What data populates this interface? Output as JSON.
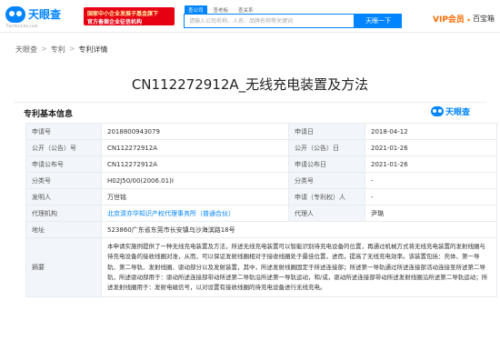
{
  "header": {
    "logo_text": "天眼查",
    "logo_sub": "TianYanCha.com",
    "promo_line1": "国家中小企业发展子基金旗下",
    "promo_line2": "官方备案企业征信机构",
    "search_tabs": [
      "查公司",
      "查老板",
      "查关系"
    ],
    "search_placeholder": "请输入公司名称、人名、品牌名称等关键词",
    "search_button": "天眼一下",
    "vip_label": "VIP会员",
    "vip_caret": "▾",
    "baobao": "百宝箱"
  },
  "breadcrumb": {
    "home": "天眼查",
    "level2": "专利",
    "current": "专利详情",
    "sep": ">"
  },
  "page_title": "CN112272912A_无线充电装置及方法",
  "section_title": "专利基本信息",
  "watermark_text": "天眼查",
  "table": {
    "application_no_label": "申请号",
    "application_no": "2018800943079",
    "application_date_label": "申请日",
    "application_date": "2018-04-12",
    "pub_no_label": "公开（公告）号",
    "pub_no": "CN112272912A",
    "pub_date_label": "公开（公告）日",
    "pub_date": "2021-01-26",
    "app_pub_no_label": "申请公布号",
    "app_pub_no": "CN112272912A",
    "app_pub_date_label": "申请公布日",
    "app_pub_date": "2021-01-26",
    "class_no_label": "分类号",
    "class_no": "H02J50/00(2006.01)I",
    "main_class_label": "分类号",
    "main_class": "-",
    "inventor_label": "发明人",
    "inventor": "万世铭",
    "applicant_label": "申请（专利权）人",
    "applicant": "-",
    "agency_label": "代理机构",
    "agency": "北京清亦华知识产权代理事务所（普通合伙）",
    "agent_label": "代理人",
    "agent": "尹璐",
    "address_label": "地址",
    "address": "523860广东省东莞市长安镇乌沙海滨路18号",
    "abstract_label": "摘要",
    "abstract": "本申请实施例提供了一种无线充电装置及方法，所述无线充电装置可以智能识别待充电设备的位置，再通过机械方式将无线充电装置的发射线圈与待充电设备的接收线圈对准，从而，可以保证发射线圈相对于接收线圈处于最佳位置，进而，提高了无线充电效率。该装置包括：壳体、第一导轨、第二导轨、发射线圈、驱动部分以及发射装置，其中，所述发射线圈固定于所述连接部；所述第一导轨通过所述连接部活动连接至所述第二导轨，所述驱动部用于：驱动所述连接部带动所述第二导轨沿所述第一导轨运动，和/或，驱动所述连接部带动所述发射线圈沿所述第二导轨运动；所述发射线圈用于：发射电磁信号，以对设置有接收线圈的待充电设备进行无线充电。"
  }
}
